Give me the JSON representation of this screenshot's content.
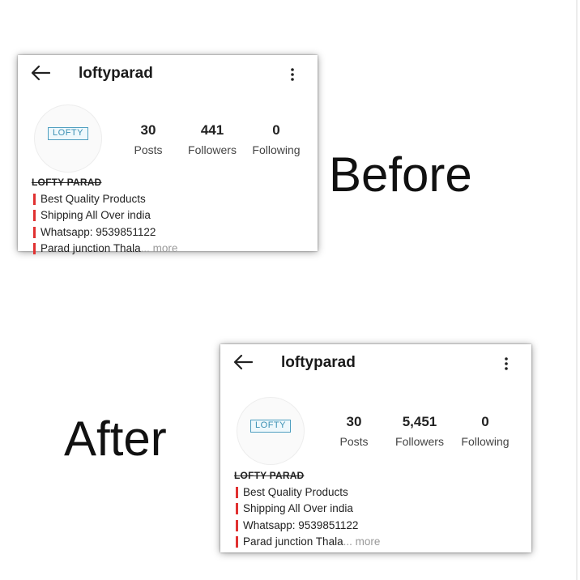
{
  "before": {
    "caption": "Before",
    "profile": {
      "username": "loftyparad",
      "logo_text": "LOFTY",
      "stats": [
        {
          "value": "30",
          "label": "Posts"
        },
        {
          "value": "441",
          "label": "Followers"
        },
        {
          "value": "0",
          "label": "Following"
        }
      ],
      "bio_name": "LOFTY PARAD",
      "bio_lines": [
        "Best Quality Products",
        "Shipping All Over india",
        "Whatsapp: 9539851122",
        "Parad junction Thala"
      ],
      "more_suffix": "... more"
    }
  },
  "after": {
    "caption": "After",
    "profile": {
      "username": "loftyparad",
      "logo_text": "LOFTY",
      "stats": [
        {
          "value": "30",
          "label": "Posts"
        },
        {
          "value": "5,451",
          "label": "Followers"
        },
        {
          "value": "0",
          "label": "Following"
        }
      ],
      "bio_name": "LOFTY PARAD",
      "bio_lines": [
        "Best Quality Products",
        "Shipping All Over india",
        "Whatsapp: 9539851122",
        "Parad junction Thala"
      ],
      "more_suffix": "... more"
    }
  },
  "colors": {
    "accent": "#e03131",
    "logo": "#3a8fb3",
    "muted": "#999999"
  },
  "icons": {
    "back": "back-arrow-icon",
    "menu": "more-vertical-icon"
  }
}
